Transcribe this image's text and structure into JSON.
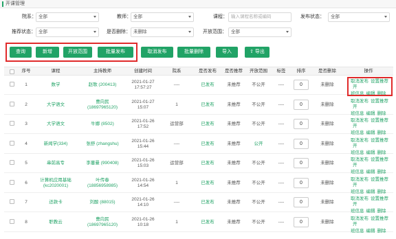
{
  "page": {
    "title": "开课管理"
  },
  "filters": {
    "department": {
      "label": "院系：",
      "value": "全部"
    },
    "teacher": {
      "label": "教师：",
      "value": "全部"
    },
    "course": {
      "label": "课程：",
      "placeholder": "输入课程名称或编码"
    },
    "publish_status": {
      "label": "发布状态：",
      "value": "全部"
    },
    "recommend_status": {
      "label": "推荐状态：",
      "value": "全部"
    },
    "deleted": {
      "label": "是否删除：",
      "value": "未删除"
    },
    "open_scope": {
      "label": "开放范围：",
      "value": "全部"
    }
  },
  "toolbar": {
    "query": "查询",
    "add": "新增",
    "open_scope": "开放范围",
    "batch_publish": "批量发布",
    "cancel_publish": "取消发布",
    "batch_delete": "批量删除",
    "import": "导入",
    "export": "导出"
  },
  "table": {
    "headers": [
      "序号",
      "课程",
      "主持教师",
      "创建时间",
      "院系",
      "是否发布",
      "是否推荐",
      "开放范围",
      "标签",
      "排序",
      "是否删除",
      "操作"
    ],
    "rows": [
      {
        "no": "1",
        "course": "数学",
        "teacher": "赵歌 (200413)",
        "date": "2021-01-27",
        "time": "17:57:27",
        "dept": "----",
        "published": "已发布",
        "recommended": "未推荐",
        "scope": "不公开",
        "tag": "----",
        "sort": "0",
        "deleted": "未删除"
      },
      {
        "no": "2",
        "course": "大学语文",
        "teacher": "曹向民",
        "teacher2": "(18697965120)",
        "date": "2021-01-27",
        "time": "15:07",
        "dept": "1",
        "published": "已发布",
        "recommended": "未推荐",
        "scope": "不公开",
        "tag": "----",
        "sort": "0",
        "deleted": "未删除"
      },
      {
        "no": "3",
        "course": "大学语文",
        "teacher": "牛娜 (8502)",
        "date": "2021-01-26",
        "time": "17:52",
        "dept": "运营部",
        "published": "已发布",
        "recommended": "未推荐",
        "scope": "不公开",
        "tag": "----",
        "sort": "0",
        "deleted": "未删除"
      },
      {
        "no": "4",
        "course": "新闻学(334)",
        "teacher": "张舒 (zhangshu)",
        "date": "2021-01-26",
        "time": "15:44",
        "dept": "----",
        "published": "已发布",
        "recommended": "未推荐",
        "scope": "公开",
        "tag": "----",
        "sort": "0",
        "deleted": "未删除"
      },
      {
        "no": "5",
        "course": "串前高专",
        "teacher": "李蔓曼 (990408)",
        "date": "2021-01-26",
        "time": "15:03",
        "dept": "运营部",
        "published": "已发布",
        "recommended": "未推荐",
        "scope": "不公开",
        "tag": "----",
        "sort": "0",
        "deleted": "未删除"
      },
      {
        "no": "6",
        "course": "计算机应用基础",
        "course2": "(kc2020001)",
        "teacher": "叶传春",
        "teacher2": "(18856958985)",
        "date": "2021-01-26",
        "time": "14:54",
        "dept": "1",
        "published": "已发布",
        "recommended": "未推荐",
        "scope": "不公开",
        "tag": "----",
        "sort": "0",
        "deleted": "未删除"
      },
      {
        "no": "7",
        "course": "还款卡",
        "teacher": "刘酸 (88015)",
        "date": "2021-01-26",
        "time": "14:10",
        "dept": "----",
        "published": "已发布",
        "recommended": "未推荐",
        "scope": "不公开",
        "tag": "----",
        "sort": "0",
        "deleted": "未删除"
      },
      {
        "no": "8",
        "course": "职教云",
        "teacher": "曹向民",
        "teacher2": "(18697965120)",
        "date": "2021-01-26",
        "time": "10:18",
        "dept": "1",
        "published": "已发布",
        "recommended": "未推荐",
        "scope": "不公开",
        "tag": "----",
        "sort": "0",
        "deleted": "未删除"
      }
    ],
    "ops": {
      "unpublish": "取消发布",
      "set_recommend": "设置推荐",
      "open": "开",
      "class_info": "班信息",
      "edit": "编辑",
      "delete": "删除"
    }
  },
  "colors": {
    "accent": "#21a366",
    "highlight": "#e02a2a"
  }
}
